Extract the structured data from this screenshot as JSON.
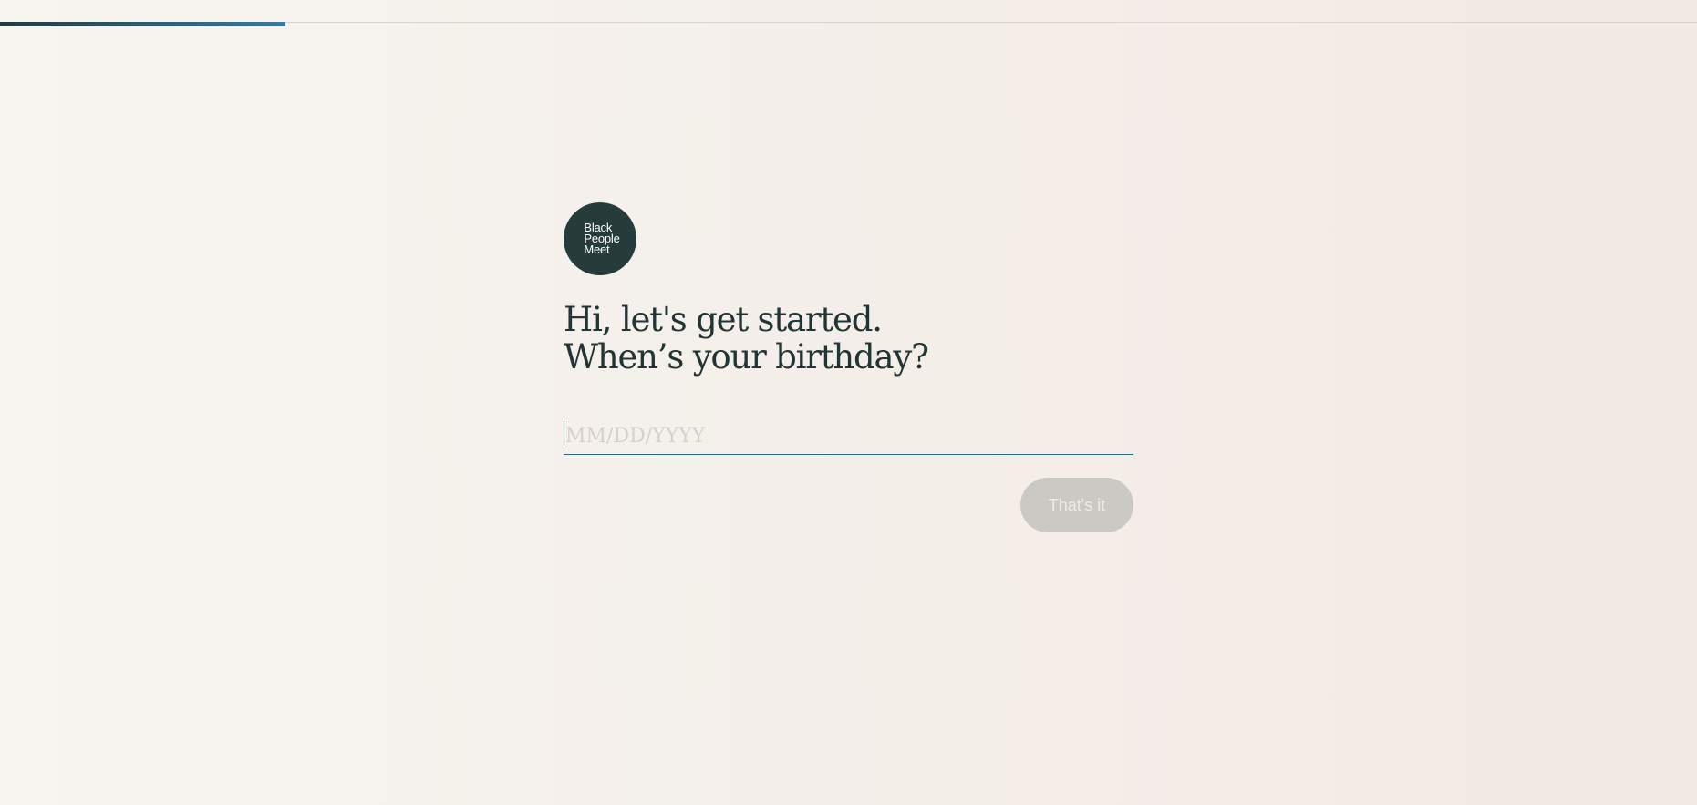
{
  "progress": {
    "fraction": 0.168
  },
  "logo": {
    "line1": "Black",
    "line2": "People",
    "line3": "Meet"
  },
  "heading": {
    "line1": "Hi, let's get started.",
    "line2": "When’s your birthday?"
  },
  "birthday_field": {
    "value": "",
    "placeholder": "MM/DD/YYYY"
  },
  "submit": {
    "label": "That's it"
  },
  "colors": {
    "brand_dark": "#263c3b",
    "accent_blue": "#3c7a9c",
    "disabled_button": "#cbc9c4"
  }
}
